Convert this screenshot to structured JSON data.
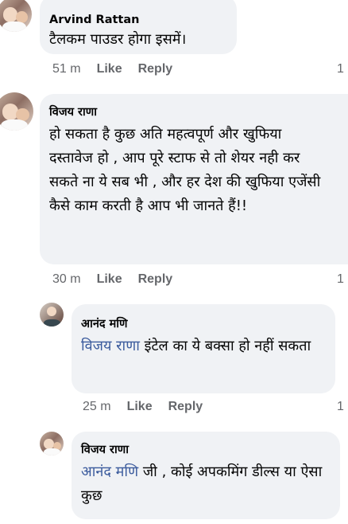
{
  "comments": [
    {
      "author": "Arvind Rattan",
      "text": "टैलकम पाउडर होगा इसमें।",
      "time": "51 m",
      "like": "Like",
      "reply": "Reply",
      "count_clipped": "1"
    },
    {
      "author": "विजय राणा",
      "text": "हो सकता है कुछ अति महत्वपूर्ण और खुफिया दस्तावेज हो , आप पूरे स्टाफ से तो शेयर नही कर सकते ना ये सब भी , और हर देश की खुफिया एजेंसी कैसे काम करती है आप भी जानते हैं!!",
      "time": "30 m",
      "like": "Like",
      "reply": "Reply",
      "count_clipped": "1"
    },
    {
      "author": "आनंद मणि",
      "mention": "विजय राणा",
      "text": " इंटेल का ये बक्सा हो नहीं सकता",
      "time": "25 m",
      "like": "Like",
      "reply": "Reply",
      "count_clipped": "1"
    },
    {
      "author": "विजय राणा",
      "mention": "आनंद मणि",
      "text": " जी , कोई अपकमिंग डील्स या ऐसा कुछ"
    }
  ]
}
